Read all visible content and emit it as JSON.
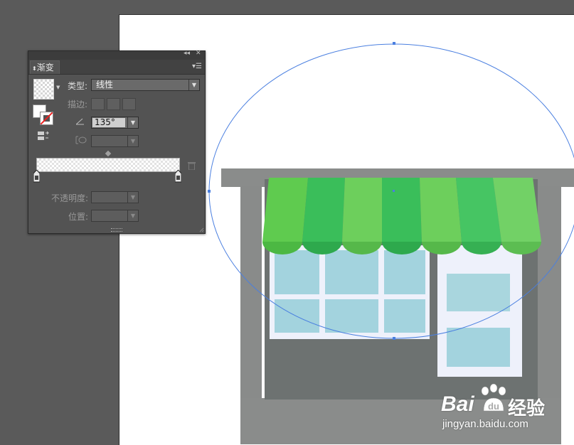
{
  "panel": {
    "tab_label": "渐变",
    "type_label": "类型:",
    "type_value": "线性",
    "stroke_label": "描边:",
    "angle_value": "135°",
    "aspect_value": "",
    "opacity_label": "不透明度:",
    "location_label": "位置:",
    "opacity_value": "",
    "location_value": ""
  },
  "icons": {
    "collapse": "double-chevron-icon",
    "close": "close-icon",
    "panel_menu": "panel-menu-icon",
    "reverse": "reverse-gradient-icon",
    "angle": "angle-icon",
    "aspect": "aspect-ratio-icon",
    "delete_stop": "trash-icon"
  },
  "artwork": {
    "awning_stripe_colors": [
      "#5fcb4f",
      "#3abe5a",
      "#6dcf5c",
      "#3abe5a",
      "#6dcf5c",
      "#46c563",
      "#72d166"
    ],
    "window_glass_color": "#a3d3de",
    "building_color": "#8a8c8b",
    "selection_color": "#4a7fe0"
  },
  "watermark": {
    "brand_left": "Bai",
    "brand_right": "经验",
    "url": "jingyan.baidu.com"
  }
}
